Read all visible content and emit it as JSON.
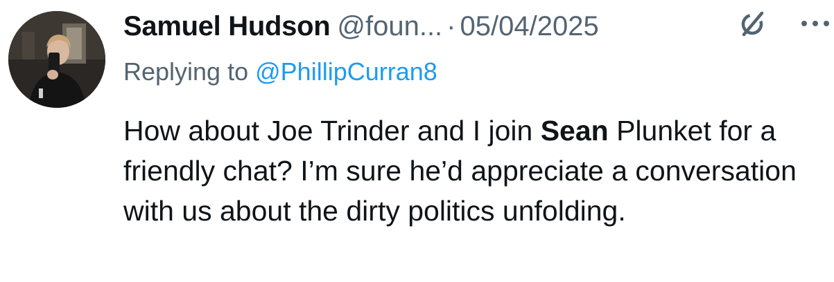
{
  "author": {
    "display_name": "Samuel Hudson",
    "handle": "@foun...",
    "separator": "·",
    "date": "05/04/2025"
  },
  "icons": {
    "grok": "grok-slash-circle-icon",
    "more": "more-dots-icon"
  },
  "reply": {
    "prefix": "Replying to",
    "mention": "@PhillipCurran8"
  },
  "body": {
    "part1": "How about Joe Trinder and I join ",
    "bold": "Sean",
    "part2": " Plunket for a friendly chat? I’m sure he’d appreciate a conversation with us about the dirty politics unfolding."
  },
  "colors": {
    "text": "#0f1419",
    "secondary": "#536471",
    "link": "#1d9bf0",
    "background": "#ffffff"
  }
}
